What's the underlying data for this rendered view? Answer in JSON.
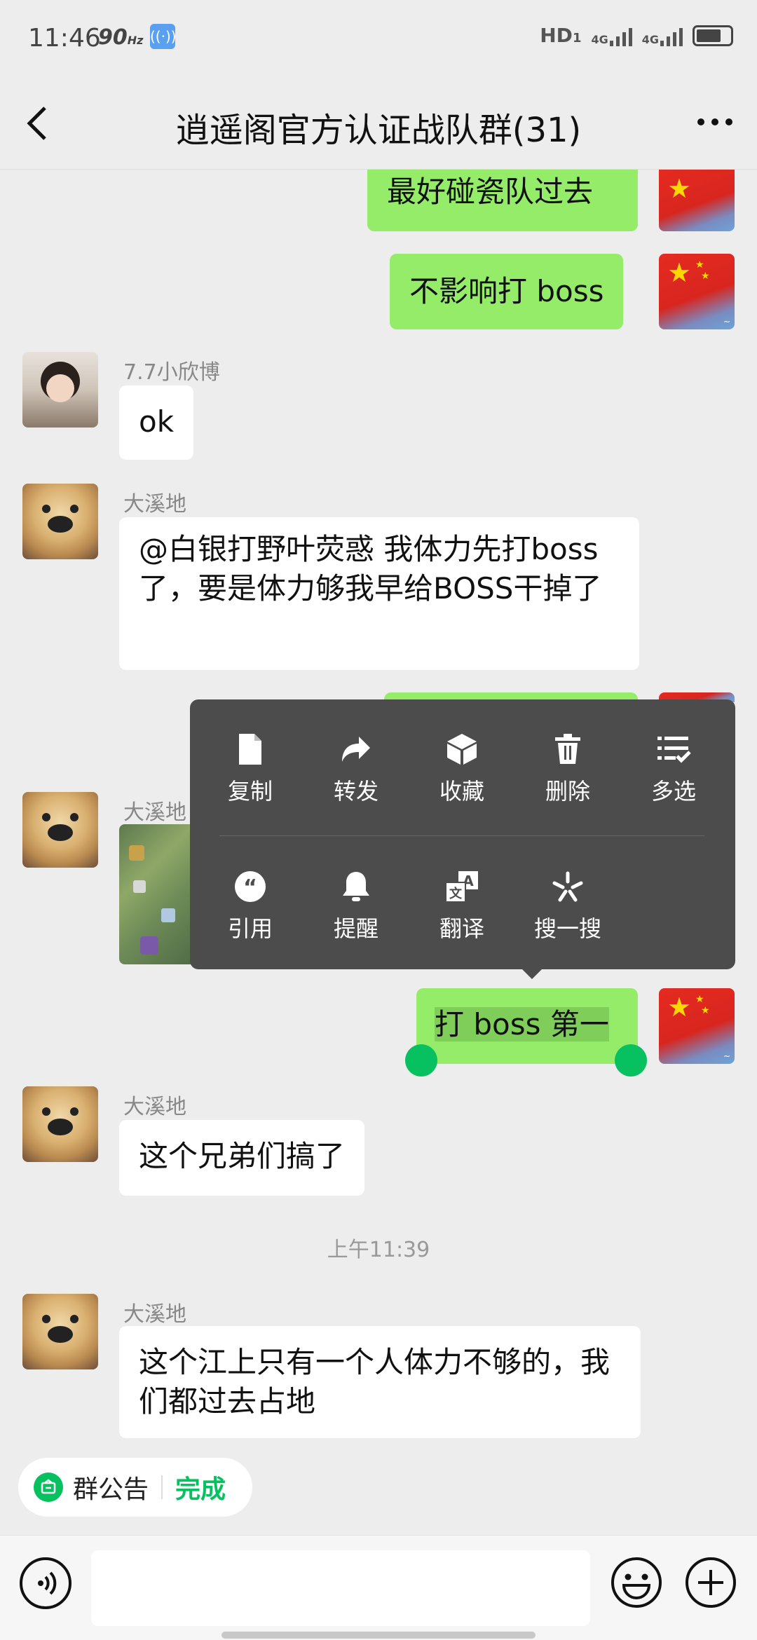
{
  "status_bar": {
    "time": "11:46",
    "refresh_rate": "90",
    "refresh_unit": "Hz",
    "hd": "HD",
    "hd_sub": "1",
    "net1": "4G",
    "net2": "4G"
  },
  "nav": {
    "title": "逍遥阁官方认证战队群(31)"
  },
  "messages": [
    {
      "side": "me",
      "text": "最好碰瓷队过去"
    },
    {
      "side": "me",
      "text": "不影响打 boss"
    },
    {
      "side": "other",
      "sender": "7.7小欣博",
      "text": "ok"
    },
    {
      "side": "other",
      "sender": "大溪地",
      "text": "@白银打野叶荧惑  我体力先打boss了，要是体力够我早给BOSS干掉了"
    },
    {
      "side": "other",
      "sender": "大溪地",
      "text": ""
    },
    {
      "side": "me",
      "text": "打 boss 第一",
      "selected": true
    },
    {
      "side": "other",
      "sender": "大溪地",
      "text": "这个兄弟们搞了"
    },
    {
      "side": "other",
      "sender": "大溪地",
      "text": "这个江上只有一个人体力不够的，我们都过去占地"
    }
  ],
  "time_separator": "上午11:39",
  "context_menu": {
    "row1": [
      {
        "label": "复制",
        "icon": "document-icon"
      },
      {
        "label": "转发",
        "icon": "forward-icon"
      },
      {
        "label": "收藏",
        "icon": "cube-icon"
      },
      {
        "label": "删除",
        "icon": "trash-icon"
      },
      {
        "label": "多选",
        "icon": "multi-select-icon"
      }
    ],
    "row2": [
      {
        "label": "引用",
        "icon": "quote-icon"
      },
      {
        "label": "提醒",
        "icon": "bell-icon"
      },
      {
        "label": "翻译",
        "icon": "translate-icon"
      },
      {
        "label": "搜一搜",
        "icon": "search-sparkle-icon"
      }
    ]
  },
  "notice": {
    "label": "群公告",
    "done": "完成"
  },
  "colors": {
    "accent": "#07c160",
    "my_bubble": "#95ec69",
    "menu_bg": "#4c4c4c"
  }
}
